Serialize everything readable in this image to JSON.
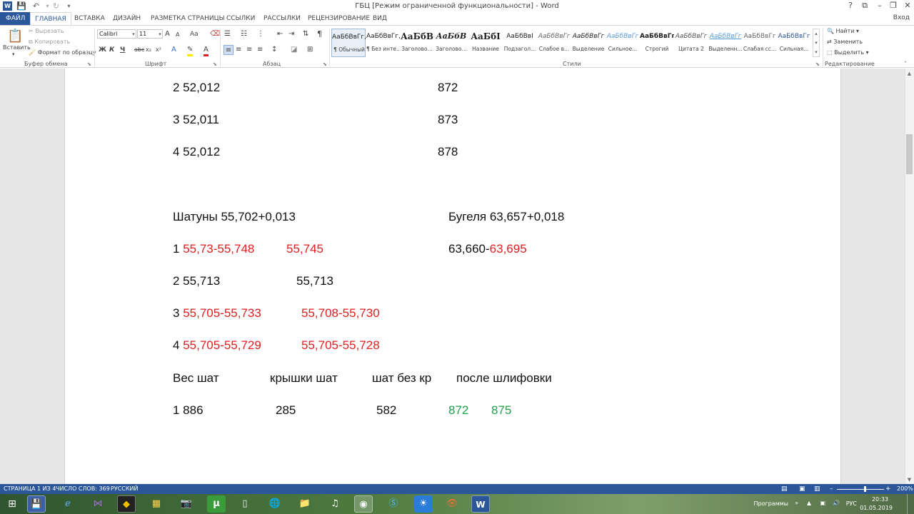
{
  "window": {
    "title": "ГБЦ [Режим ограниченной функциональности] - Word",
    "controls": [
      "?",
      "⧉",
      "–",
      "❐",
      "✕"
    ]
  },
  "ribbon_tabs": [
    "ФАЙЛ",
    "ГЛАВНАЯ",
    "ВСТАВКА",
    "ДИЗАЙН",
    "РАЗМЕТКА СТРАНИЦЫ",
    "ССЫЛКИ",
    "РАССЫЛКИ",
    "РЕЦЕНЗИРОВАНИЕ",
    "ВИД"
  ],
  "signin": "Вход",
  "clipboard": {
    "paste": "Вставить",
    "cut": "Вырезать",
    "copy": "Копировать",
    "format_painter": "Формат по образцу",
    "label": "Буфер обмена"
  },
  "font": {
    "name": "Calibri",
    "size": "11",
    "label": "Шрифт",
    "change_case": "Aa",
    "bold": "Ж",
    "italic": "К",
    "underline": "Ч",
    "strike": "abc",
    "subscript": "x₂",
    "superscript": "x²",
    "grow": "A",
    "shrink": "A"
  },
  "paragraph": {
    "label": "Абзац"
  },
  "styles": {
    "label": "Стили",
    "items": [
      {
        "preview": "АаБбВвГг,",
        "name": "¶ Обычный"
      },
      {
        "preview": "АаБбВвГг,",
        "name": "¶ Без инте..."
      },
      {
        "preview": "АаБбВ",
        "name": "Заголово..."
      },
      {
        "preview": "АаБбВ",
        "name": "Заголово..."
      },
      {
        "preview": "АаБбІ",
        "name": "Название"
      },
      {
        "preview": "АаБбВвІ",
        "name": "Подзагол..."
      },
      {
        "preview": "АаБбВвГг",
        "name": "Слабое в..."
      },
      {
        "preview": "АаБбВвГг",
        "name": "Выделение"
      },
      {
        "preview": "АаБбВвГг",
        "name": "Сильное..."
      },
      {
        "preview": "АаБбВвГг,",
        "name": "Строгий"
      },
      {
        "preview": "АаБбВвГг",
        "name": "Цитата 2"
      },
      {
        "preview": "АаБбВвГг",
        "name": "Выделенн..."
      },
      {
        "preview": "АаБбВвГг",
        "name": "Слабая сс..."
      },
      {
        "preview": "АаБбВвГг",
        "name": "Сильная..."
      }
    ]
  },
  "editing": {
    "label": "Редактирование",
    "find": "Найти",
    "replace": "Заменить",
    "select": "Выделить"
  },
  "document": {
    "lines": [
      {
        "a": "2 52,012",
        "b": "872"
      },
      {
        "a": "3 52,011",
        "b": "873"
      },
      {
        "a": "4 52,012",
        "b": "878"
      }
    ],
    "shatuny_title": "Шатуны 55,702+0,013",
    "bugelya_title": "Бугеля 63,657+0,018",
    "r1_num": "1 ",
    "r1_range": "55,73-55,748",
    "r1_val": "55,745",
    "r1_bug_a": "63,660-",
    "r1_bug_b": "63,695",
    "r2_text": "2 55,713",
    "r2_val": "55,713",
    "r3_num": "3 ",
    "r3_range": "55,705-55,733",
    "r3_val": "55,708-55,730",
    "r4_num": "4 ",
    "r4_range": "55,705-55,729",
    "r4_val": "55,705-55,728",
    "weights_header": [
      "Вес шат",
      "крышки шат",
      "шат без кр",
      "после шлифовки"
    ],
    "weights_row": {
      "a": "1 886",
      "b": "285",
      "c": "582",
      "d": "872",
      "e": "875"
    }
  },
  "statusbar": {
    "page": "СТРАНИЦА 1 ИЗ 4",
    "words": "ЧИСЛО СЛОВ: 369",
    "lang": "РУССКИЙ",
    "zoom": "200%"
  },
  "taskbar": {
    "programs": "Программы",
    "lang": "РУС",
    "time": "20:33",
    "date": "01.05.2019"
  },
  "colors": {
    "brand": "#2b579a",
    "red_text": "#e02020",
    "green_text": "#1ea34a"
  }
}
